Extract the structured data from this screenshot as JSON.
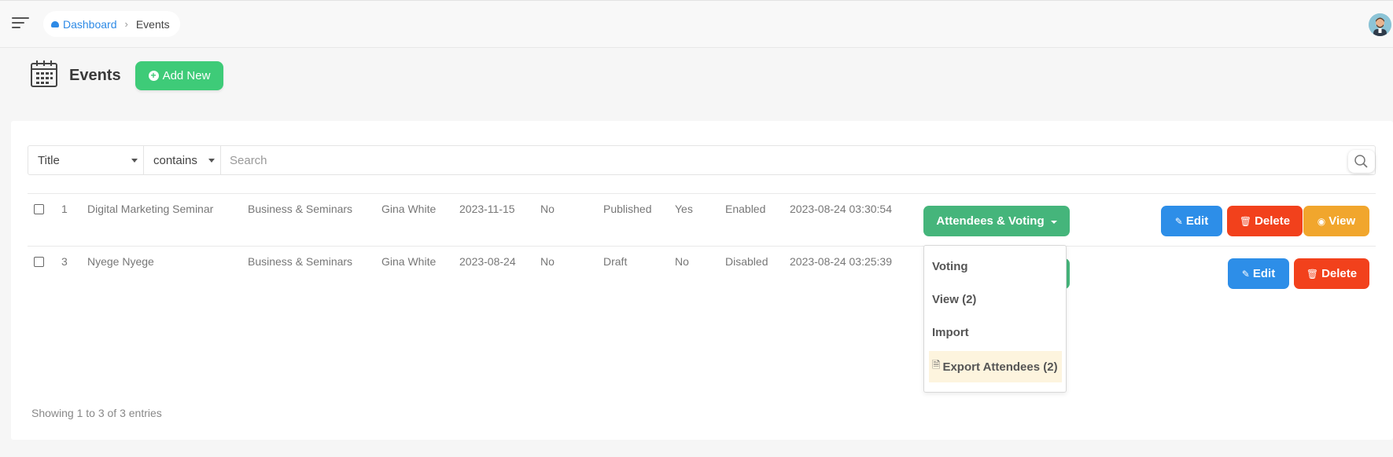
{
  "breadcrumb": {
    "home": "Dashboard",
    "separator": "›",
    "current": "Events"
  },
  "page": {
    "title": "Events",
    "add_button": "Add New"
  },
  "filter": {
    "field": "Title",
    "operator": "contains",
    "search_placeholder": "Search"
  },
  "rows": [
    {
      "id": "1",
      "title": "Digital Marketing Seminar",
      "category": "Business & Seminars",
      "organizer": "Gina White",
      "date": "2023-11-15",
      "flag1": "No",
      "status": "Published",
      "flag2": "Yes",
      "state": "Enabled",
      "created": "2023-08-24 03:30:54",
      "actions": {
        "dropdown": "Attendees & Voting",
        "edit": "Edit",
        "delete": "Delete",
        "view": "View"
      }
    },
    {
      "id": "3",
      "title": "Nyege Nyege",
      "category": "Business & Seminars",
      "organizer": "Gina White",
      "date": "2023-08-24",
      "flag1": "No",
      "status": "Draft",
      "flag2": "No",
      "state": "Disabled",
      "created": "2023-08-24 03:25:39",
      "actions": {
        "edit": "Edit",
        "delete": "Delete"
      }
    }
  ],
  "dropdown_menu": {
    "items": [
      "Voting",
      "View (2)",
      "Import"
    ],
    "highlighted": "Export Attendees (2)"
  },
  "footer": {
    "showing": "Showing 1 to 3 of 3 entries"
  },
  "colors": {
    "green": "#45b57b",
    "blue": "#2d8ee8",
    "red": "#f2411c",
    "orange": "#f1a62d",
    "link": "#2d8ae6"
  },
  "icons": [
    "menu-icon",
    "dashboard-icon",
    "avatar",
    "calendar-icon",
    "plus-circle-icon",
    "search-icon",
    "edit-icon",
    "trash-icon",
    "eye-icon",
    "export-icon"
  ]
}
